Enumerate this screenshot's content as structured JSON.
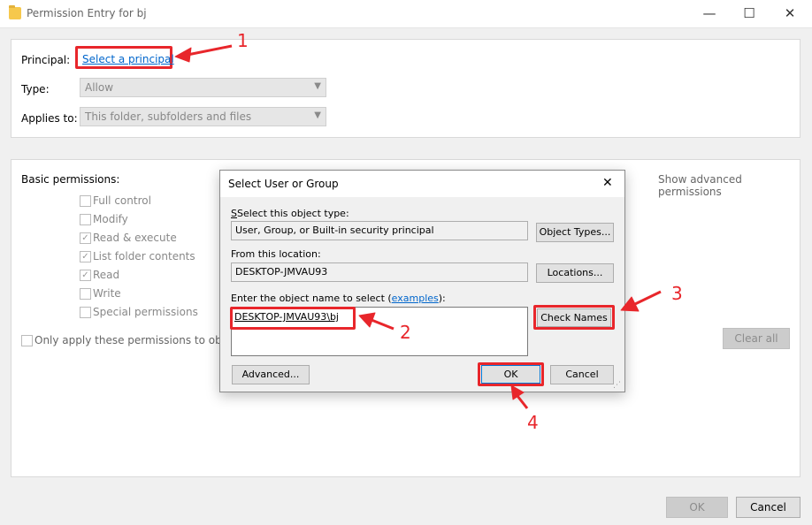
{
  "window": {
    "title": "Permission Entry for bj",
    "minimize_glyph": "—",
    "maximize_glyph": "☐",
    "close_glyph": "✕"
  },
  "top_panel": {
    "principal_label": "Principal:",
    "principal_link": "Select a principal",
    "type_label": "Type:",
    "type_value": "Allow",
    "applies_label": "Applies to:",
    "applies_value": "This folder, subfolders and files"
  },
  "permissions": {
    "heading": "Basic permissions:",
    "show_advanced": "Show advanced permissions",
    "items": [
      {
        "label": "Full control",
        "checked": false
      },
      {
        "label": "Modify",
        "checked": false
      },
      {
        "label": "Read & execute",
        "checked": true
      },
      {
        "label": "List folder contents",
        "checked": true
      },
      {
        "label": "Read",
        "checked": true
      },
      {
        "label": "Write",
        "checked": false
      },
      {
        "label": "Special permissions",
        "checked": false
      }
    ],
    "only_apply_label": "Only apply these permissions to objects",
    "clear_all": "Clear all"
  },
  "footer": {
    "ok": "OK",
    "cancel": "Cancel"
  },
  "dialog": {
    "title": "Select User or Group",
    "close_glyph": "✕",
    "object_type_label": "Select this object type:",
    "object_type_value": "User, Group, or Built-in security principal",
    "object_types_button": "Object Types...",
    "location_label": "From this location:",
    "location_value": "DESKTOP-JMVAU93",
    "locations_button": "Locations...",
    "name_label_prefix": "Enter the object name to select (",
    "name_label_link": "examples",
    "name_label_suffix": "):",
    "name_value": "DESKTOP-JMVAU93\\bj",
    "check_names_button": "Check Names",
    "advanced_button": "Advanced...",
    "ok_button": "OK",
    "cancel_button": "Cancel"
  },
  "annotations": {
    "n1": "1",
    "n2": "2",
    "n3": "3",
    "n4": "4",
    "color": "#e8262b"
  }
}
